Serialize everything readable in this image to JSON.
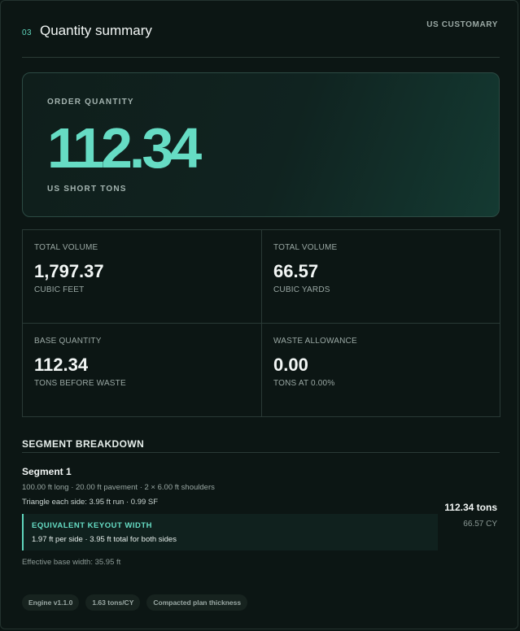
{
  "header": {
    "step": "03",
    "title": "Quantity summary",
    "unit_system": "US CUSTOMARY"
  },
  "hero": {
    "label": "ORDER QUANTITY",
    "value": "112.34",
    "unit": "US SHORT TONS"
  },
  "metrics": [
    {
      "label": "TOTAL VOLUME",
      "value": "1,797.37",
      "unit": "CUBIC FEET"
    },
    {
      "label": "TOTAL VOLUME",
      "value": "66.57",
      "unit": "CUBIC YARDS"
    },
    {
      "label": "BASE QUANTITY",
      "value": "112.34",
      "unit": "TONS BEFORE WASTE"
    },
    {
      "label": "WASTE ALLOWANCE",
      "value": "0.00",
      "unit": "TONS AT 0.00%"
    }
  ],
  "breakdown": {
    "title": "SEGMENT BREAKDOWN",
    "segment": {
      "name": "Segment 1",
      "dims": "100.00 ft long · 20.00 ft pavement · 2 × 6.00 ft shoulders",
      "triangle": "Triangle each side: 3.95 ft run · 0.99 SF",
      "keyout_label": "EQUIVALENT KEYOUT WIDTH",
      "keyout_detail": "1.97 ft per side · 3.95 ft total for both sides",
      "effective_width": "Effective base width: 35.95 ft",
      "tons": "112.34 tons",
      "cy": "66.57 CY"
    }
  },
  "chips": [
    "Engine v1.1.0",
    "1.63 tons/CY",
    "Compacted plan thickness"
  ],
  "colors": {
    "accent": "#66dcc4",
    "background": "#0c1614",
    "border": "#2a3a36"
  }
}
